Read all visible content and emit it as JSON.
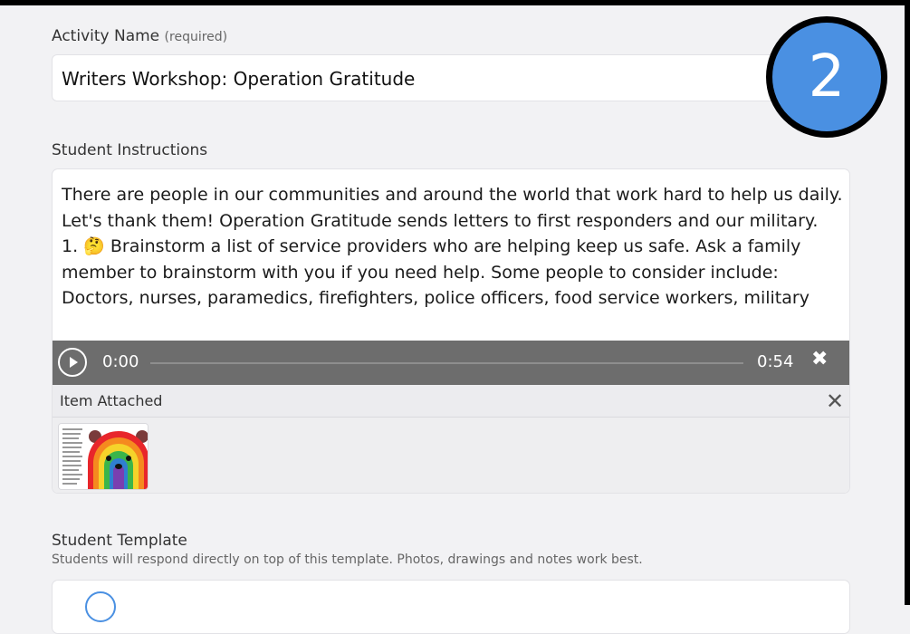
{
  "activity": {
    "label": "Activity Name",
    "required_note": "(required)",
    "value": "Writers Workshop: Operation Gratitude"
  },
  "step_badge": "2",
  "instructions": {
    "label": "Student Instructions",
    "lines": [
      "There are people in our communities and around the world that work hard to help us daily. Let's thank them! Operation Gratitude sends letters to first responders and our military.",
      "1. 🤔 Brainstorm a list of service providers who are helping keep us safe. Ask a family member to brainstorm with you if you need help. Some people to consider include: Doctors, nurses, paramedics, firefighters, police officers, food service workers, military"
    ]
  },
  "audio": {
    "current_time": "0:00",
    "total_time": "0:54",
    "close_glyph": "✖"
  },
  "attachment": {
    "title": "Item Attached",
    "close_glyph": "✕"
  },
  "template": {
    "label": "Student Template",
    "subtitle": "Students will respond directly on top of this template. Photos, drawings and notes work best."
  },
  "colors": {
    "accent": "#4a90e2",
    "audio_bar": "#6d6d6d"
  }
}
